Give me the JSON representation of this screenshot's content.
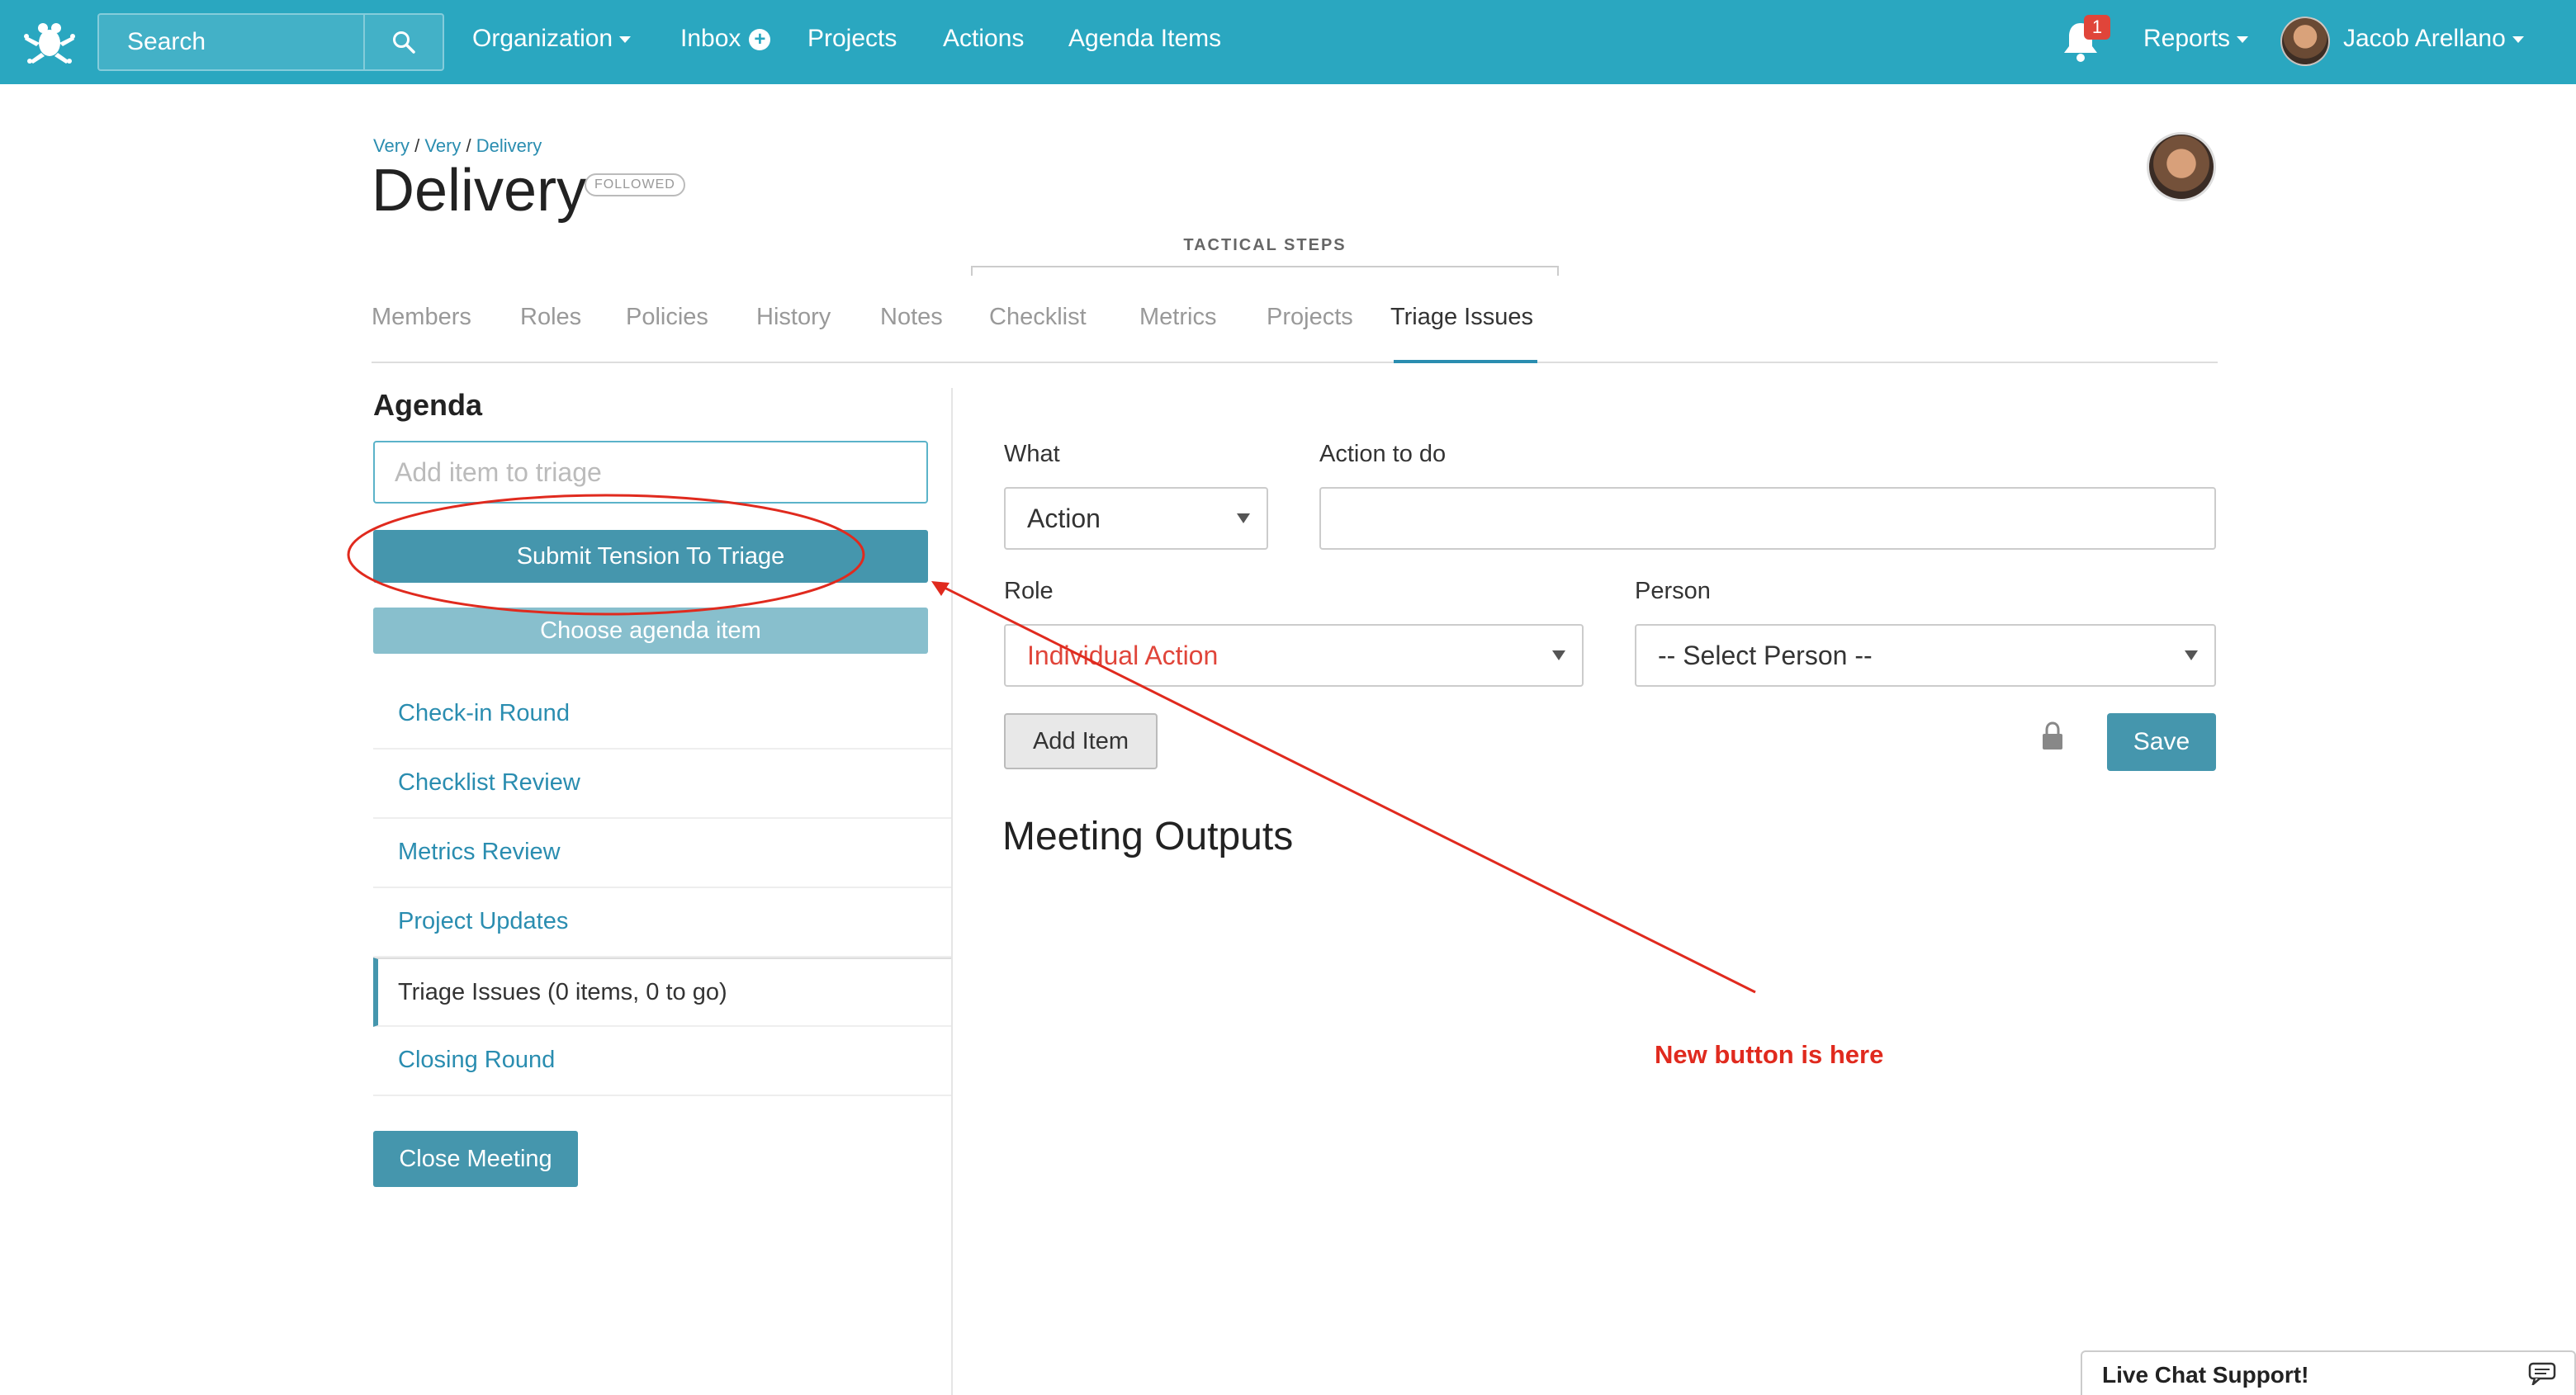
{
  "navbar": {
    "search_placeholder": "Search",
    "items": {
      "organization": "Organization",
      "inbox": "Inbox",
      "projects": "Projects",
      "actions": "Actions",
      "agenda_items": "Agenda Items"
    },
    "notification_count": "1",
    "reports": "Reports",
    "user_name": "Jacob Arellano"
  },
  "breadcrumb": [
    "Very",
    "Very",
    "Delivery"
  ],
  "page": {
    "title": "Delivery",
    "followed_badge": "FOLLOWED",
    "tactical_label": "TACTICAL STEPS"
  },
  "tabs": [
    "Members",
    "Roles",
    "Policies",
    "History",
    "Notes",
    "Checklist",
    "Metrics",
    "Projects",
    "Triage Issues"
  ],
  "active_tab": "Triage Issues",
  "agenda": {
    "title": "Agenda",
    "input_placeholder": "Add item to triage",
    "submit_label": "Submit Tension To Triage",
    "choose_label": "Choose agenda item",
    "items": [
      "Check-in Round",
      "Checklist Review",
      "Metrics Review",
      "Project Updates",
      "Triage Issues (0 items, 0 to go)",
      "Closing Round"
    ],
    "active_item": "Triage Issues (0 items, 0 to go)",
    "close_label": "Close Meeting"
  },
  "form": {
    "what_label": "What",
    "what_value": "Action",
    "action_label": "Action to do",
    "action_value": "",
    "role_label": "Role",
    "role_value": "Individual Action",
    "person_label": "Person",
    "person_value": "-- Select Person --",
    "add_item_label": "Add Item",
    "save_label": "Save",
    "outputs_title": "Meeting Outputs"
  },
  "annotation": {
    "text": "New button is here",
    "color": "#e02a1e"
  },
  "live_chat": "Live Chat Support!",
  "colors": {
    "navbar": "#2aa7c0",
    "primary_button": "#4596ad",
    "link": "#2a8db0"
  }
}
